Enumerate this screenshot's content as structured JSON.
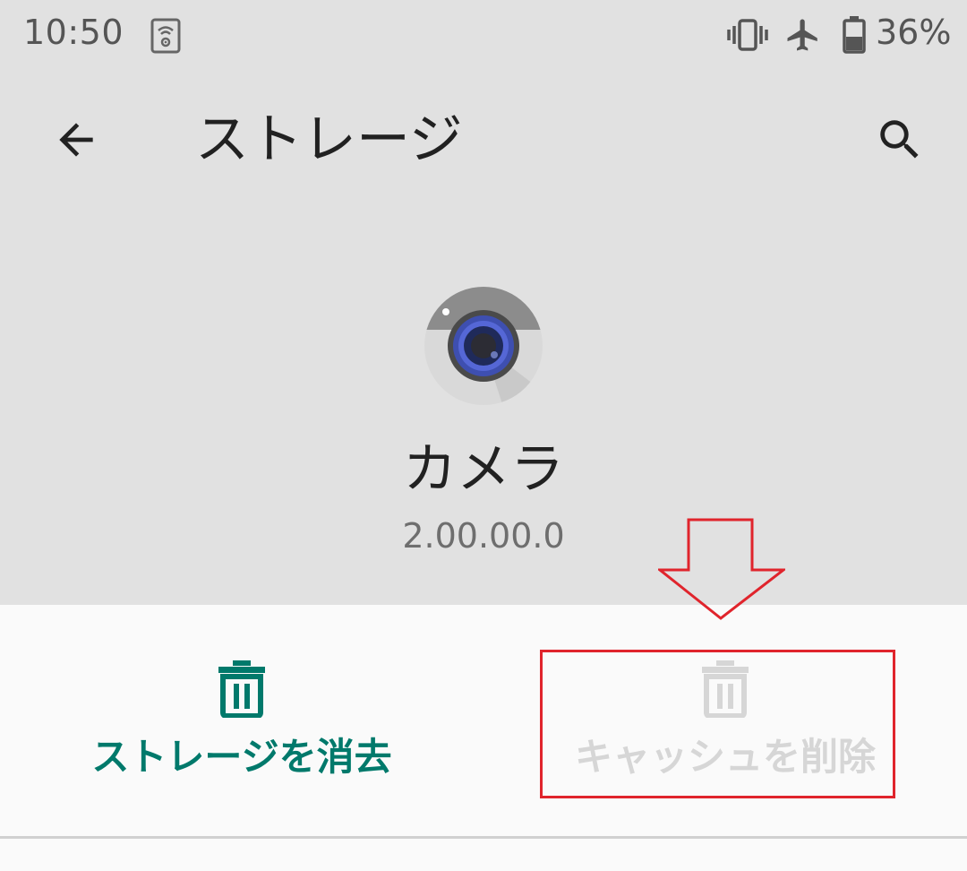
{
  "status_bar": {
    "time": "10:50",
    "battery_percent": "36%",
    "icons": [
      "wifi-settings-icon",
      "vibrate-icon",
      "airplane-mode-icon",
      "battery-icon"
    ]
  },
  "app_bar": {
    "title": "ストレージ",
    "back_icon": "arrow-back-icon",
    "search_icon": "search-icon"
  },
  "app_info": {
    "name": "カメラ",
    "version": "2.00.00.0",
    "icon": "camera-app-icon"
  },
  "actions": {
    "clear_storage": {
      "label": "ストレージを消去",
      "icon": "trash-icon",
      "enabled": true
    },
    "clear_cache": {
      "label": "キャッシュを削除",
      "icon": "trash-icon",
      "enabled": false
    }
  },
  "colors": {
    "accent": "#00796b",
    "disabled": "#d6d6d6",
    "annotation": "#e0242c",
    "background": "#e1e1e1",
    "panel": "#fafafa"
  }
}
